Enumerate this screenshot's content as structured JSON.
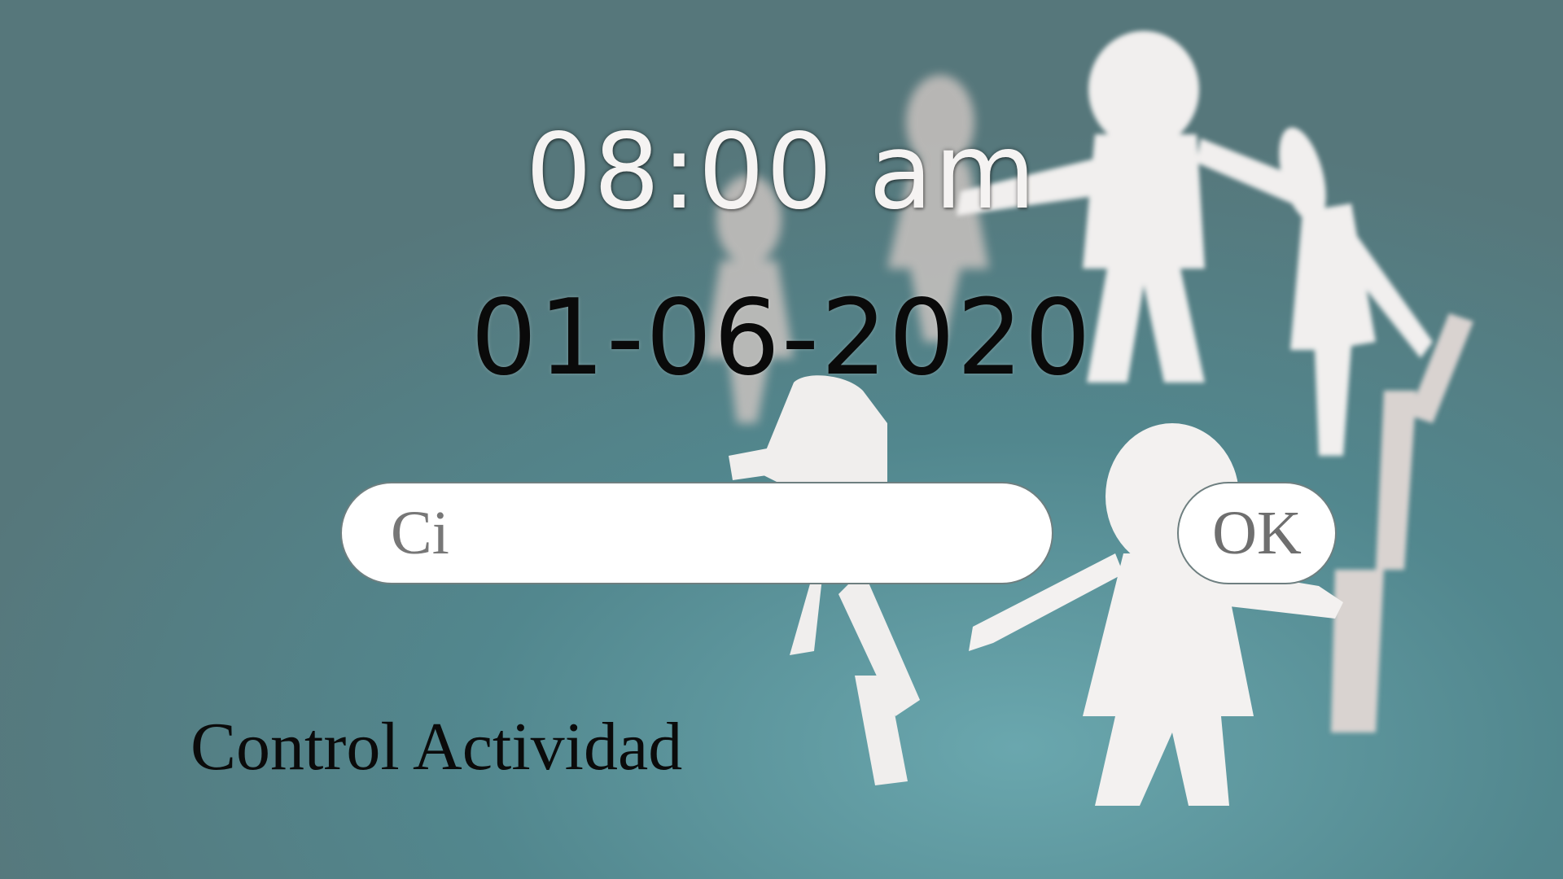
{
  "clock": {
    "time": "08:00 am",
    "date": "01-06-2020"
  },
  "form": {
    "ci_placeholder": "Ci",
    "ci_value": "",
    "ok_label": "OK"
  },
  "app": {
    "title": "Control Actividad"
  },
  "background": {
    "description_icon": "paper-people-circle-illustration",
    "colors": {
      "backdrop": "#4f8991",
      "paper": "#f2f0ef",
      "paper_shadow": "#c9c2bf"
    }
  }
}
